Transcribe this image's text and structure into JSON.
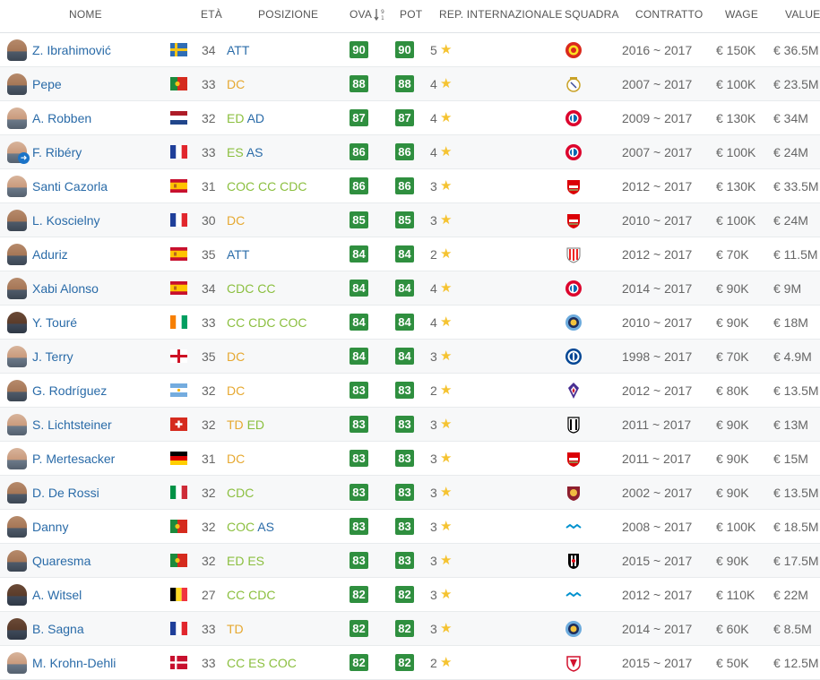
{
  "columns": {
    "name": "NOME",
    "age": "ETÀ",
    "position": "POSIZIONE",
    "ova": "OVA",
    "pot": "POT",
    "rep": "REP. INTERNAZIONALE",
    "club": "SQUADRA",
    "contract": "CONTRATTO",
    "wage": "WAGE",
    "value": "VALUE"
  },
  "rating_color": "#2f8f3f",
  "position_colors": {
    "att": "#2a6ba8",
    "mid": "#8bbf3f",
    "def": "#e6a830"
  },
  "players": [
    {
      "name": "Z. Ibrahimović",
      "flag": "sweden-flag",
      "age": "34",
      "positions": [
        {
          "t": "ATT",
          "c": "att"
        }
      ],
      "ova": "90",
      "pot": "90",
      "rep": "5",
      "club": "manchester-united-crest",
      "contract": "2016 ~ 2017",
      "wage": "€ 150K",
      "value": "€ 36.5M",
      "skin": "mid"
    },
    {
      "name": "Pepe",
      "flag": "portugal-flag",
      "age": "33",
      "positions": [
        {
          "t": "DC",
          "c": "def"
        }
      ],
      "ova": "88",
      "pot": "88",
      "rep": "4",
      "club": "real-madrid-crest",
      "contract": "2007 ~ 2017",
      "wage": "€ 100K",
      "value": "€ 23.5M",
      "skin": "mid"
    },
    {
      "name": "A. Robben",
      "flag": "netherlands-flag",
      "age": "32",
      "positions": [
        {
          "t": "ED",
          "c": "mid"
        },
        {
          "t": "AD",
          "c": "att"
        }
      ],
      "ova": "87",
      "pot": "87",
      "rep": "4",
      "club": "bayern-crest",
      "contract": "2009 ~ 2017",
      "wage": "€ 130K",
      "value": "€ 34M",
      "skin": "light"
    },
    {
      "name": "F. Ribéry",
      "flag": "france-flag",
      "age": "33",
      "positions": [
        {
          "t": "ES",
          "c": "mid"
        },
        {
          "t": "AS",
          "c": "att"
        }
      ],
      "ova": "86",
      "pot": "86",
      "rep": "4",
      "club": "bayern-crest",
      "contract": "2007 ~ 2017",
      "wage": "€ 100K",
      "value": "€ 24M",
      "skin": "light",
      "loan": true
    },
    {
      "name": "Santi Cazorla",
      "flag": "spain-flag",
      "age": "31",
      "positions": [
        {
          "t": "COC",
          "c": "mid"
        },
        {
          "t": "CC",
          "c": "mid"
        },
        {
          "t": "CDC",
          "c": "mid"
        }
      ],
      "ova": "86",
      "pot": "86",
      "rep": "3",
      "club": "arsenal-crest",
      "contract": "2012 ~ 2017",
      "wage": "€ 130K",
      "value": "€ 33.5M",
      "skin": "light"
    },
    {
      "name": "L. Koscielny",
      "flag": "france-flag",
      "age": "30",
      "positions": [
        {
          "t": "DC",
          "c": "def"
        }
      ],
      "ova": "85",
      "pot": "85",
      "rep": "3",
      "club": "arsenal-crest",
      "contract": "2010 ~ 2017",
      "wage": "€ 100K",
      "value": "€ 24M",
      "skin": "mid"
    },
    {
      "name": "Aduriz",
      "flag": "spain-flag",
      "age": "35",
      "positions": [
        {
          "t": "ATT",
          "c": "att"
        }
      ],
      "ova": "84",
      "pot": "84",
      "rep": "2",
      "club": "athletic-bilbao-crest",
      "contract": "2012 ~ 2017",
      "wage": "€ 70K",
      "value": "€ 11.5M",
      "skin": "mid"
    },
    {
      "name": "Xabi Alonso",
      "flag": "spain-flag",
      "age": "34",
      "positions": [
        {
          "t": "CDC",
          "c": "mid"
        },
        {
          "t": "CC",
          "c": "mid"
        }
      ],
      "ova": "84",
      "pot": "84",
      "rep": "4",
      "club": "bayern-crest",
      "contract": "2014 ~ 2017",
      "wage": "€ 90K",
      "value": "€ 9M",
      "skin": "mid"
    },
    {
      "name": "Y. Touré",
      "flag": "ivory-coast-flag",
      "age": "33",
      "positions": [
        {
          "t": "CC",
          "c": "mid"
        },
        {
          "t": "CDC",
          "c": "mid"
        },
        {
          "t": "COC",
          "c": "mid"
        }
      ],
      "ova": "84",
      "pot": "84",
      "rep": "4",
      "club": "manchester-city-crest",
      "contract": "2010 ~ 2017",
      "wage": "€ 90K",
      "value": "€ 18M",
      "skin": "dark"
    },
    {
      "name": "J. Terry",
      "flag": "england-flag",
      "age": "35",
      "positions": [
        {
          "t": "DC",
          "c": "def"
        }
      ],
      "ova": "84",
      "pot": "84",
      "rep": "3",
      "club": "chelsea-crest",
      "contract": "1998 ~ 2017",
      "wage": "€ 70K",
      "value": "€ 4.9M",
      "skin": "light"
    },
    {
      "name": "G. Rodríguez",
      "flag": "argentina-flag",
      "age": "32",
      "positions": [
        {
          "t": "DC",
          "c": "def"
        }
      ],
      "ova": "83",
      "pot": "83",
      "rep": "2",
      "club": "fiorentina-crest",
      "contract": "2012 ~ 2017",
      "wage": "€ 80K",
      "value": "€ 13.5M",
      "skin": "mid"
    },
    {
      "name": "S. Lichtsteiner",
      "flag": "switzerland-flag",
      "age": "32",
      "positions": [
        {
          "t": "TD",
          "c": "def"
        },
        {
          "t": "ED",
          "c": "mid"
        }
      ],
      "ova": "83",
      "pot": "83",
      "rep": "3",
      "club": "juventus-crest",
      "contract": "2011 ~ 2017",
      "wage": "€ 90K",
      "value": "€ 13M",
      "skin": "light"
    },
    {
      "name": "P. Mertesacker",
      "flag": "germany-flag",
      "age": "31",
      "positions": [
        {
          "t": "DC",
          "c": "def"
        }
      ],
      "ova": "83",
      "pot": "83",
      "rep": "3",
      "club": "arsenal-crest",
      "contract": "2011 ~ 2017",
      "wage": "€ 90K",
      "value": "€ 15M",
      "skin": "light"
    },
    {
      "name": "D. De Rossi",
      "flag": "italy-flag",
      "age": "32",
      "positions": [
        {
          "t": "CDC",
          "c": "mid"
        }
      ],
      "ova": "83",
      "pot": "83",
      "rep": "3",
      "club": "roma-crest",
      "contract": "2002 ~ 2017",
      "wage": "€ 90K",
      "value": "€ 13.5M",
      "skin": "mid"
    },
    {
      "name": "Danny",
      "flag": "portugal-flag",
      "age": "32",
      "positions": [
        {
          "t": "COC",
          "c": "mid"
        },
        {
          "t": "AS",
          "c": "att"
        }
      ],
      "ova": "83",
      "pot": "83",
      "rep": "3",
      "club": "zenit-crest",
      "contract": "2008 ~ 2017",
      "wage": "€ 100K",
      "value": "€ 18.5M",
      "skin": "mid"
    },
    {
      "name": "Quaresma",
      "flag": "portugal-flag",
      "age": "32",
      "positions": [
        {
          "t": "ED",
          "c": "mid"
        },
        {
          "t": "ES",
          "c": "mid"
        }
      ],
      "ova": "83",
      "pot": "83",
      "rep": "3",
      "club": "besiktas-crest",
      "contract": "2015 ~ 2017",
      "wage": "€ 90K",
      "value": "€ 17.5M",
      "skin": "mid"
    },
    {
      "name": "A. Witsel",
      "flag": "belgium-flag",
      "age": "27",
      "positions": [
        {
          "t": "CC",
          "c": "mid"
        },
        {
          "t": "CDC",
          "c": "mid"
        }
      ],
      "ova": "82",
      "pot": "82",
      "rep": "3",
      "club": "zenit-crest",
      "contract": "2012 ~ 2017",
      "wage": "€ 110K",
      "value": "€ 22M",
      "skin": "dark"
    },
    {
      "name": "B. Sagna",
      "flag": "france-flag",
      "age": "33",
      "positions": [
        {
          "t": "TD",
          "c": "def"
        }
      ],
      "ova": "82",
      "pot": "82",
      "rep": "3",
      "club": "manchester-city-crest",
      "contract": "2014 ~ 2017",
      "wage": "€ 60K",
      "value": "€ 8.5M",
      "skin": "dark"
    },
    {
      "name": "M. Krohn-Dehli",
      "flag": "denmark-flag",
      "age": "33",
      "positions": [
        {
          "t": "CC",
          "c": "mid"
        },
        {
          "t": "ES",
          "c": "mid"
        },
        {
          "t": "COC",
          "c": "mid"
        }
      ],
      "ova": "82",
      "pot": "82",
      "rep": "2",
      "club": "sevilla-crest",
      "contract": "2015 ~ 2017",
      "wage": "€ 50K",
      "value": "€ 12.5M",
      "skin": "light"
    }
  ]
}
